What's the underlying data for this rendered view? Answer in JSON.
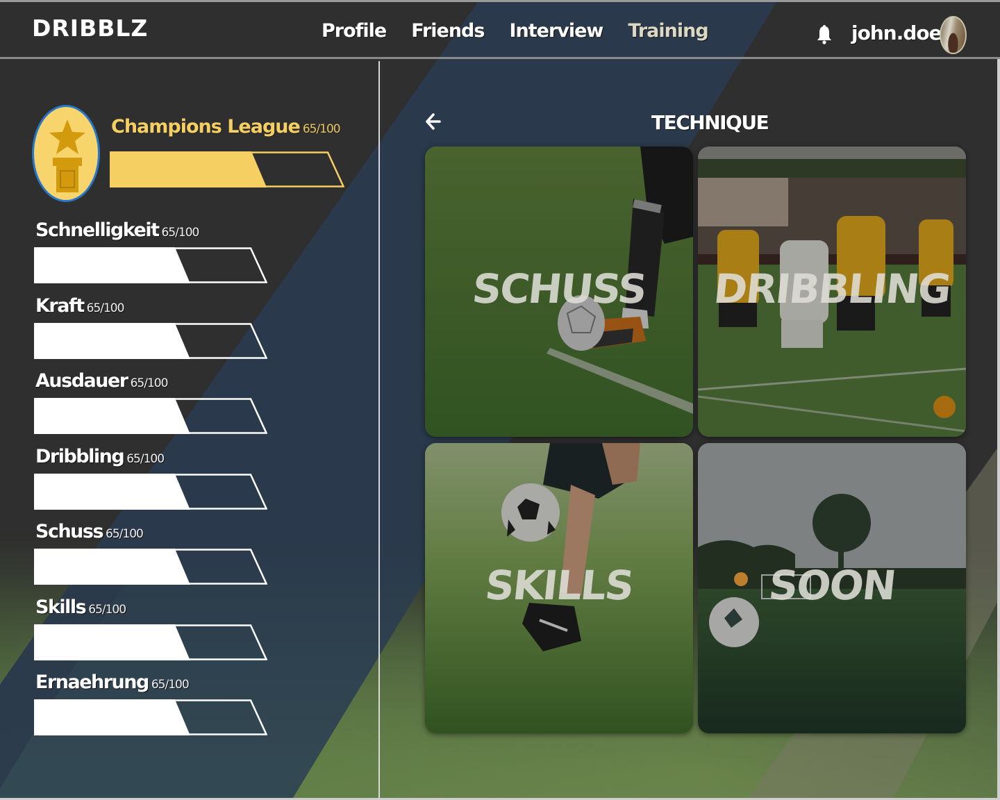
{
  "app": {
    "logo": "DRIBBLZ",
    "username": "john.doe"
  },
  "nav": {
    "items": [
      {
        "label": "Profile",
        "active": false
      },
      {
        "label": "Friends",
        "active": false
      },
      {
        "label": "Interview",
        "active": false
      },
      {
        "label": "Training",
        "active": true
      }
    ]
  },
  "icons": {
    "notifications": "bell-icon",
    "back": "arrow-left-icon",
    "league": "trophy-star-icon",
    "avatar": "user-avatar"
  },
  "league": {
    "title": "Champions League",
    "score_text": "65/100",
    "progress": 0.65
  },
  "stats": [
    {
      "label": "Schnelligkeit",
      "score_text": "65/100",
      "progress": 0.65
    },
    {
      "label": "Kraft",
      "score_text": "65/100",
      "progress": 0.65
    },
    {
      "label": "Ausdauer",
      "score_text": "65/100",
      "progress": 0.65
    },
    {
      "label": "Dribbling",
      "score_text": "65/100",
      "progress": 0.65
    },
    {
      "label": "Schuss",
      "score_text": "65/100",
      "progress": 0.65
    },
    {
      "label": "Skills",
      "score_text": "65/100",
      "progress": 0.65
    },
    {
      "label": "Ernaehrung",
      "score_text": "65/100",
      "progress": 0.65
    }
  ],
  "section": {
    "title": "TECHNIQUE",
    "tiles": [
      {
        "label": "SCHUSS",
        "image": "player kicking ball on grass"
      },
      {
        "label": "DRIBBLING",
        "image": "players in match dribbling"
      },
      {
        "label": "SKILLS",
        "image": "juggling ball on grass"
      },
      {
        "label": "SOON",
        "image": "ball on field at sunset"
      }
    ]
  },
  "colors": {
    "background": "#2f2f2f",
    "accent_blue": "#2a3a4c",
    "league_gold": "#f6cf62",
    "trophy_ring": "#2877c9",
    "bar_fill": "#ffffff"
  }
}
